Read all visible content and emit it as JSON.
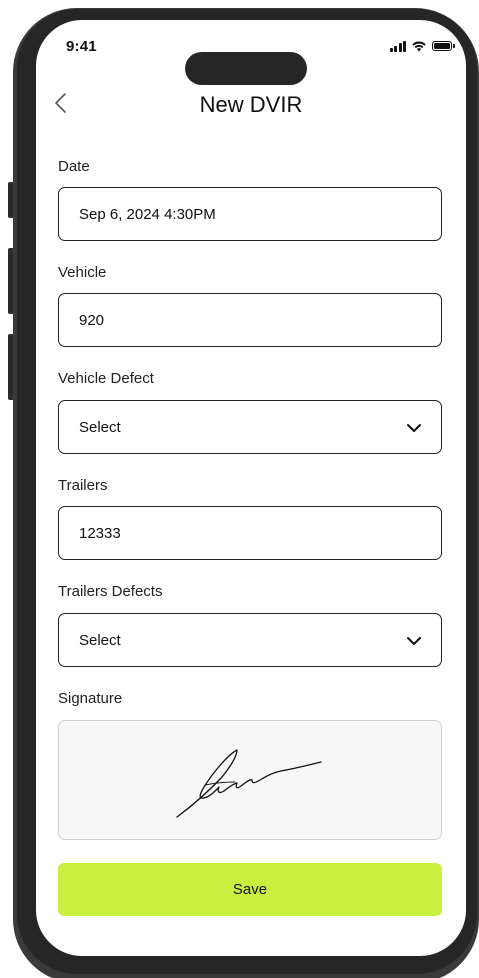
{
  "status_bar": {
    "time": "9:41",
    "icons": [
      "cellular-signal-icon",
      "wifi-icon",
      "battery-icon"
    ]
  },
  "header": {
    "title": "New DVIR",
    "back_icon": "chevron-left-icon"
  },
  "form": {
    "date": {
      "label": "Date",
      "value": "Sep 6, 2024 4:30PM"
    },
    "vehicle": {
      "label": "Vehicle",
      "value": "920"
    },
    "vehicle_defect": {
      "label": "Vehicle Defect",
      "value": "Select"
    },
    "trailers": {
      "label": "Trailers",
      "value": "12333"
    },
    "trailers_defects": {
      "label": "Trailers Defects",
      "value": "Select"
    },
    "signature": {
      "label": "Signature"
    }
  },
  "actions": {
    "save_label": "Save"
  },
  "colors": {
    "accent": "#c8f03e",
    "text": "#111111",
    "border": "#222222",
    "signature_bg": "#f7f7f7"
  }
}
